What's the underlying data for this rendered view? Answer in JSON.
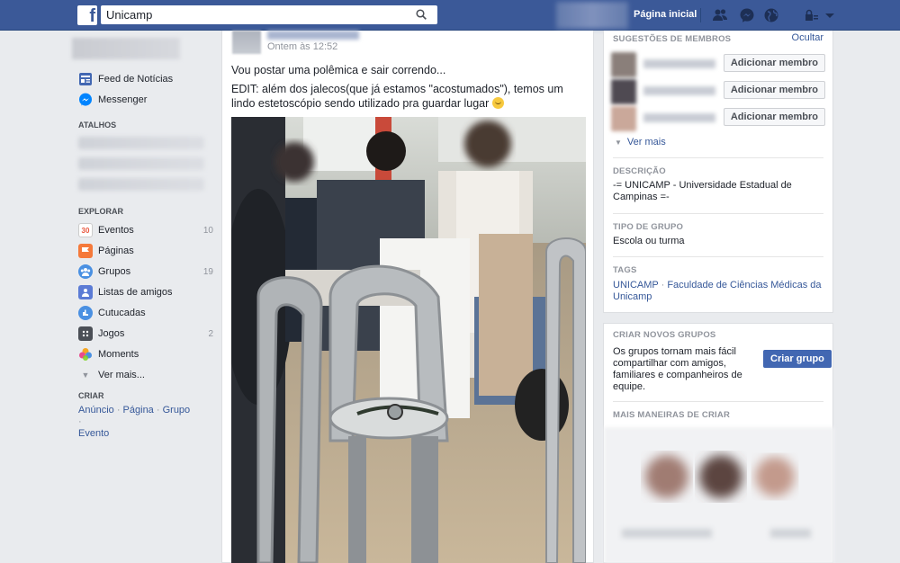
{
  "topbar": {
    "logo_letter": "f",
    "search_value": "Unicamp",
    "home_label": "Página inicial",
    "icons": [
      "search-icon",
      "friends-icon",
      "messenger-icon",
      "globe-icon",
      "lock-icon",
      "chevron-down-icon"
    ]
  },
  "left_nav": {
    "items": [
      {
        "label": "Feed de Notícias",
        "icon": "news-feed-icon",
        "color": "#4267b2"
      },
      {
        "label": "Messenger",
        "icon": "messenger-icon",
        "color": "#0084ff"
      }
    ],
    "shortcuts_heading": "ATALHOS",
    "explore_heading": "EXPLORAR",
    "explore_items": [
      {
        "label": "Eventos",
        "count": "10",
        "icon": "calendar-icon",
        "glyph": "30",
        "color": "#e9573f"
      },
      {
        "label": "Páginas",
        "count": "",
        "icon": "flag-icon",
        "glyph": "",
        "color": "#f5793a"
      },
      {
        "label": "Grupos",
        "count": "19",
        "icon": "groups-icon",
        "glyph": "",
        "color": "#4a90e2"
      },
      {
        "label": "Listas de amigos",
        "count": "",
        "icon": "friend-list-icon",
        "glyph": "",
        "color": "#5b7bd5"
      },
      {
        "label": "Cutucadas",
        "count": "",
        "icon": "poke-icon",
        "glyph": "",
        "color": "#4a90e2"
      },
      {
        "label": "Jogos",
        "count": "2",
        "icon": "games-icon",
        "glyph": "",
        "color": "#4b4f56"
      },
      {
        "label": "Moments",
        "count": "",
        "icon": "moments-icon",
        "glyph": "",
        "color": "#e94a8d"
      }
    ],
    "see_more": "Ver mais...",
    "create_heading": "CRIAR",
    "create_links": [
      "Anúncio",
      "Página",
      "Grupo",
      "Evento"
    ]
  },
  "post": {
    "timestamp": "Ontem às 12:52",
    "line1": "Vou postar uma polêmica e sair correndo...",
    "line2": "EDIT: além dos jalecos(que já estamos \"acostumados\"), temos um lindo estetoscópio sendo utilizado pra guardar lugar",
    "emoji": "smiley-icon"
  },
  "sidebar": {
    "suggestions_heading": "SUGESTÕES DE MEMBROS",
    "hide_label": "Ocultar",
    "add_member_label": "Adicionar membro",
    "see_more_label": "Ver mais",
    "description_heading": "DESCRIÇÃO",
    "description_text": "-= UNICAMP - Universidade Estadual de Campinas =-",
    "group_type_heading": "TIPO DE GRUPO",
    "group_type_value": "Escola ou turma",
    "tags_heading": "TAGS",
    "tags": [
      "UNICAMP",
      "Faculdade de Ciências Médicas da Unicamp"
    ],
    "create_groups_heading": "CRIAR NOVOS GRUPOS",
    "create_groups_text": "Os grupos tornam mais fácil compartilhar com amigos, familiares e companheiros de equipe.",
    "create_group_button": "Criar grupo",
    "more_ways_heading": "MAIS MANEIRAS DE CRIAR"
  }
}
